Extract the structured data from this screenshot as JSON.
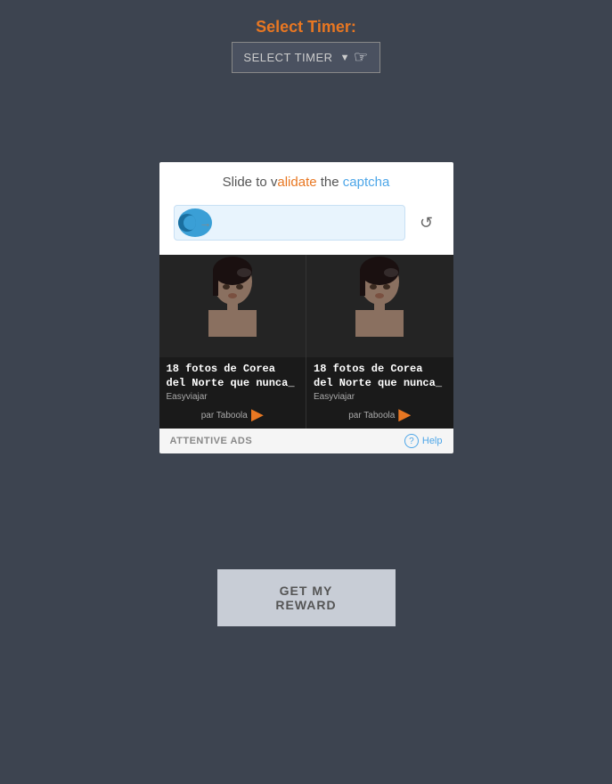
{
  "header": {
    "label": "Select Timer:",
    "dropdown_text": "SELECT TIMER",
    "dropdown_arrow": "▼"
  },
  "captcha": {
    "instruction": "Slide to validate the captcha",
    "instruction_parts": {
      "prefix": "Slide to v",
      "highlight1_text": "alidate",
      "middle": " the ",
      "highlight2_text": "captcha"
    }
  },
  "ad": {
    "title1": "18 fotos de Corea del Norte que nunca_",
    "source1": "Easyviajar",
    "taboola1": "par Taboola",
    "title2": "18 fotos de Corea del Norte que nunca_",
    "source2": "Easyviajar",
    "taboola2": "par Taboola",
    "footer_brand": "ATTENTIVE ADS",
    "help_label": "Help"
  },
  "reward": {
    "button_label": "GET MY REWARD"
  }
}
